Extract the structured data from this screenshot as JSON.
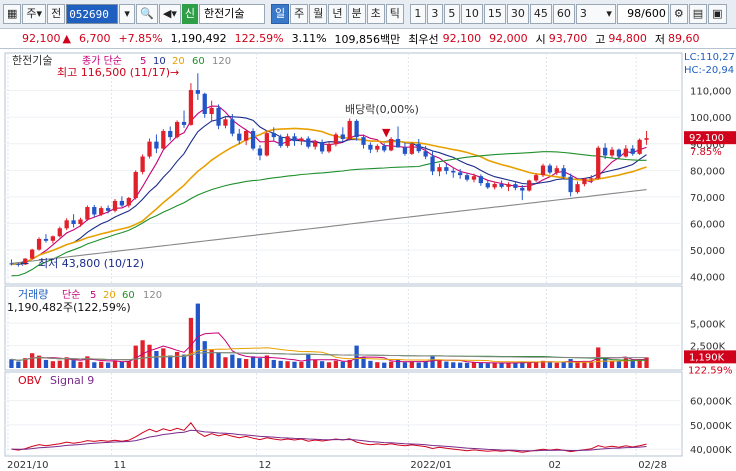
{
  "toolbar": {
    "code": "052690",
    "badge": "신",
    "name": "한전기술",
    "period_buttons": [
      "일",
      "주",
      "월",
      "년",
      "분",
      "초",
      "틱"
    ],
    "minute_buttons": [
      "1",
      "3",
      "5",
      "10",
      "15",
      "30",
      "45",
      "60"
    ],
    "interval_value": "3",
    "count": "98/600",
    "mode_label": "주",
    "mode_label2": "전"
  },
  "quote": {
    "price": "92,100",
    "change": "6,700",
    "change_pct": "+7.85%",
    "volume": "1,190,492",
    "volume_ratio": "122.59%",
    "turnover": "3.11%",
    "amount": "109,856백만",
    "best_ask_label": "최우선",
    "best_ask": "92,100",
    "best_bid": "92,000",
    "open_label": "시",
    "open": "93,700",
    "high_label": "고",
    "high": "94,800",
    "low_label": "저",
    "low": "89,60"
  },
  "price_panel": {
    "title": "한전기술",
    "ma_label": "종가 단순",
    "ma_periods": [
      "5",
      "10",
      "20",
      "60",
      "120"
    ],
    "ma_colors": [
      "#c8007a",
      "#1b2b8a",
      "#e8a000",
      "#1f8f2c",
      "#888888"
    ],
    "max_label": "최고 116,500 (11/17)",
    "min_label": "최저 43,800 (10/12)",
    "event_label": "배당락(0,00%)",
    "lc_label": "LC:110,27",
    "hc_label": "HC:-20,94",
    "y_ticks": [
      "110,000",
      "100,000",
      "90,000",
      "80,000",
      "70,000",
      "60,000",
      "50,000",
      "40,000"
    ],
    "last_price": "92,100",
    "last_pct": "7.85%"
  },
  "volume_panel": {
    "title": "거래량",
    "ma_label": "단순",
    "ma_periods": [
      "5",
      "20",
      "60",
      "120"
    ],
    "value_label": "1,190,482주(122,59%)",
    "y_ticks": [
      "5,000K",
      "2,500K"
    ],
    "last_value": "1,190K",
    "last_pct": "122.59%"
  },
  "obv_panel": {
    "title": "OBV",
    "signal_label": "Signal 9",
    "y_ticks": [
      "60,000K",
      "50,000K",
      "40,000K"
    ]
  },
  "x_axis": [
    "2021/10",
    "11",
    "12",
    "2022/01",
    "02",
    "02/28"
  ],
  "chart_data": {
    "type": "candlestick",
    "title": "한전기술",
    "ylim": [
      40000,
      116500
    ],
    "ohlc": [
      [
        45000,
        46500,
        44200,
        44800
      ],
      [
        44800,
        45200,
        43800,
        44600
      ],
      [
        44600,
        47000,
        44400,
        46800
      ],
      [
        46800,
        50500,
        46500,
        50200
      ],
      [
        50200,
        54800,
        49800,
        54200
      ],
      [
        54200,
        56000,
        52800,
        53500
      ],
      [
        53500,
        55500,
        52500,
        55200
      ],
      [
        55200,
        58800,
        54800,
        58200
      ],
      [
        58200,
        62000,
        57500,
        61200
      ],
      [
        61200,
        63500,
        58500,
        59800
      ],
      [
        59800,
        62200,
        58800,
        61500
      ],
      [
        61500,
        66800,
        61000,
        66200
      ],
      [
        66200,
        67000,
        62500,
        63400
      ],
      [
        63400,
        66500,
        62800,
        65800
      ],
      [
        65800,
        66800,
        63800,
        64800
      ],
      [
        64800,
        69200,
        64200,
        68500
      ],
      [
        68500,
        70200,
        66200,
        66800
      ],
      [
        66800,
        70000,
        66000,
        69600
      ],
      [
        69600,
        80000,
        69000,
        79400
      ],
      [
        79400,
        86000,
        78500,
        85200
      ],
      [
        85200,
        92000,
        84500,
        90800
      ],
      [
        90800,
        93500,
        86500,
        88200
      ],
      [
        88200,
        95500,
        87800,
        94800
      ],
      [
        94800,
        96500,
        91200,
        92500
      ],
      [
        92500,
        98800,
        92000,
        98200
      ],
      [
        98200,
        102500,
        96000,
        97100
      ],
      [
        97100,
        112800,
        96800,
        110200
      ],
      [
        110200,
        116500,
        106500,
        108800
      ],
      [
        108800,
        109200,
        99800,
        101200
      ],
      [
        101200,
        106200,
        98600,
        103500
      ],
      [
        103500,
        104800,
        95500,
        96800
      ],
      [
        96800,
        100500,
        95800,
        99200
      ],
      [
        99200,
        101200,
        92800,
        93800
      ],
      [
        93800,
        95600,
        89800,
        91200
      ],
      [
        91200,
        95200,
        89500,
        94800
      ],
      [
        94800,
        95800,
        87500,
        88200
      ],
      [
        88200,
        89500,
        83800,
        85600
      ],
      [
        85600,
        94800,
        85200,
        94000
      ],
      [
        94000,
        96200,
        91200,
        92500
      ],
      [
        92500,
        93500,
        88500,
        89200
      ],
      [
        89200,
        93800,
        88500,
        92800
      ],
      [
        92800,
        94000,
        89200,
        91000
      ],
      [
        91000,
        92600,
        89500,
        92000
      ],
      [
        92000,
        92800,
        88200,
        88900
      ],
      [
        88900,
        91500,
        87800,
        90600
      ],
      [
        90600,
        91600,
        86200,
        87100
      ],
      [
        87100,
        90500,
        86500,
        89800
      ],
      [
        89800,
        94200,
        89000,
        93500
      ],
      [
        93500,
        96200,
        90800,
        91800
      ],
      [
        91800,
        99500,
        91200,
        98600
      ],
      [
        98600,
        99200,
        91200,
        92500
      ],
      [
        92500,
        93500,
        88200,
        89600
      ],
      [
        89600,
        90500,
        86500,
        87800
      ],
      [
        87800,
        89800,
        86800,
        89200
      ],
      [
        89200,
        90200,
        86800,
        87500
      ],
      [
        87500,
        92500,
        87200,
        91800
      ],
      [
        91800,
        96500,
        91000,
        88600
      ],
      [
        88600,
        90500,
        85500,
        86200
      ],
      [
        86200,
        90500,
        85800,
        89900
      ],
      [
        89900,
        91800,
        86500,
        87200
      ],
      [
        87200,
        89200,
        84200,
        85200
      ],
      [
        85200,
        87500,
        78200,
        79600
      ],
      [
        79600,
        82500,
        77800,
        81200
      ],
      [
        81200,
        82500,
        78500,
        79800
      ],
      [
        79800,
        80800,
        77200,
        79200
      ],
      [
        79200,
        80500,
        76800,
        78200
      ],
      [
        78200,
        79000,
        75800,
        76500
      ],
      [
        76500,
        78800,
        75500,
        77800
      ],
      [
        77800,
        78500,
        74200,
        75200
      ],
      [
        75200,
        76200,
        73000,
        73600
      ],
      [
        73600,
        75800,
        72800,
        74900
      ],
      [
        74900,
        76200,
        73200,
        73800
      ],
      [
        73800,
        75500,
        72200,
        74800
      ],
      [
        74800,
        75800,
        72500,
        73400
      ],
      [
        73400,
        74500,
        68800,
        72400
      ],
      [
        72400,
        76500,
        72000,
        76200
      ],
      [
        76200,
        78800,
        75500,
        78200
      ],
      [
        78200,
        82500,
        77500,
        81800
      ],
      [
        81800,
        82500,
        78500,
        79200
      ],
      [
        79200,
        81800,
        78200,
        80800
      ],
      [
        80800,
        82000,
        76800,
        77600
      ],
      [
        77600,
        78800,
        70200,
        71800
      ],
      [
        71800,
        75800,
        71200,
        74800
      ],
      [
        74800,
        77200,
        74000,
        76800
      ],
      [
        76800,
        78200,
        75200,
        77000
      ],
      [
        77000,
        89200,
        76500,
        88500
      ],
      [
        88500,
        90200,
        84200,
        85600
      ],
      [
        85600,
        88800,
        84800,
        87800
      ],
      [
        87800,
        88200,
        84500,
        85200
      ],
      [
        85200,
        89500,
        84800,
        88200
      ],
      [
        88200,
        89500,
        85500,
        86200
      ],
      [
        86200,
        92000,
        85800,
        91500
      ],
      [
        91500,
        94800,
        89600,
        92100
      ]
    ],
    "volume_k": [
      980,
      720,
      1100,
      1650,
      1380,
      900,
      760,
      820,
      1200,
      880,
      690,
      1300,
      640,
      700,
      610,
      830,
      720,
      760,
      2500,
      3100,
      2600,
      1900,
      2200,
      1400,
      1800,
      1500,
      5600,
      7200,
      3000,
      2100,
      1700,
      1200,
      1500,
      1100,
      1000,
      1300,
      1100,
      1400,
      900,
      800,
      760,
      700,
      680,
      1600,
      900,
      760,
      640,
      820,
      700,
      900,
      2500,
      1200,
      800,
      650,
      600,
      700,
      900,
      640,
      720,
      610,
      700,
      1400,
      900,
      720,
      640,
      600,
      580,
      620,
      560,
      540,
      560,
      520,
      600,
      560,
      700,
      640,
      720,
      800,
      620,
      580,
      700,
      1000,
      760,
      640,
      700,
      2300,
      1200,
      800,
      760,
      1100,
      900,
      1000,
      1190
    ],
    "ma_periods": [
      5,
      10,
      20,
      60,
      120
    ],
    "obv_ylim": [
      38000,
      66000
    ]
  }
}
